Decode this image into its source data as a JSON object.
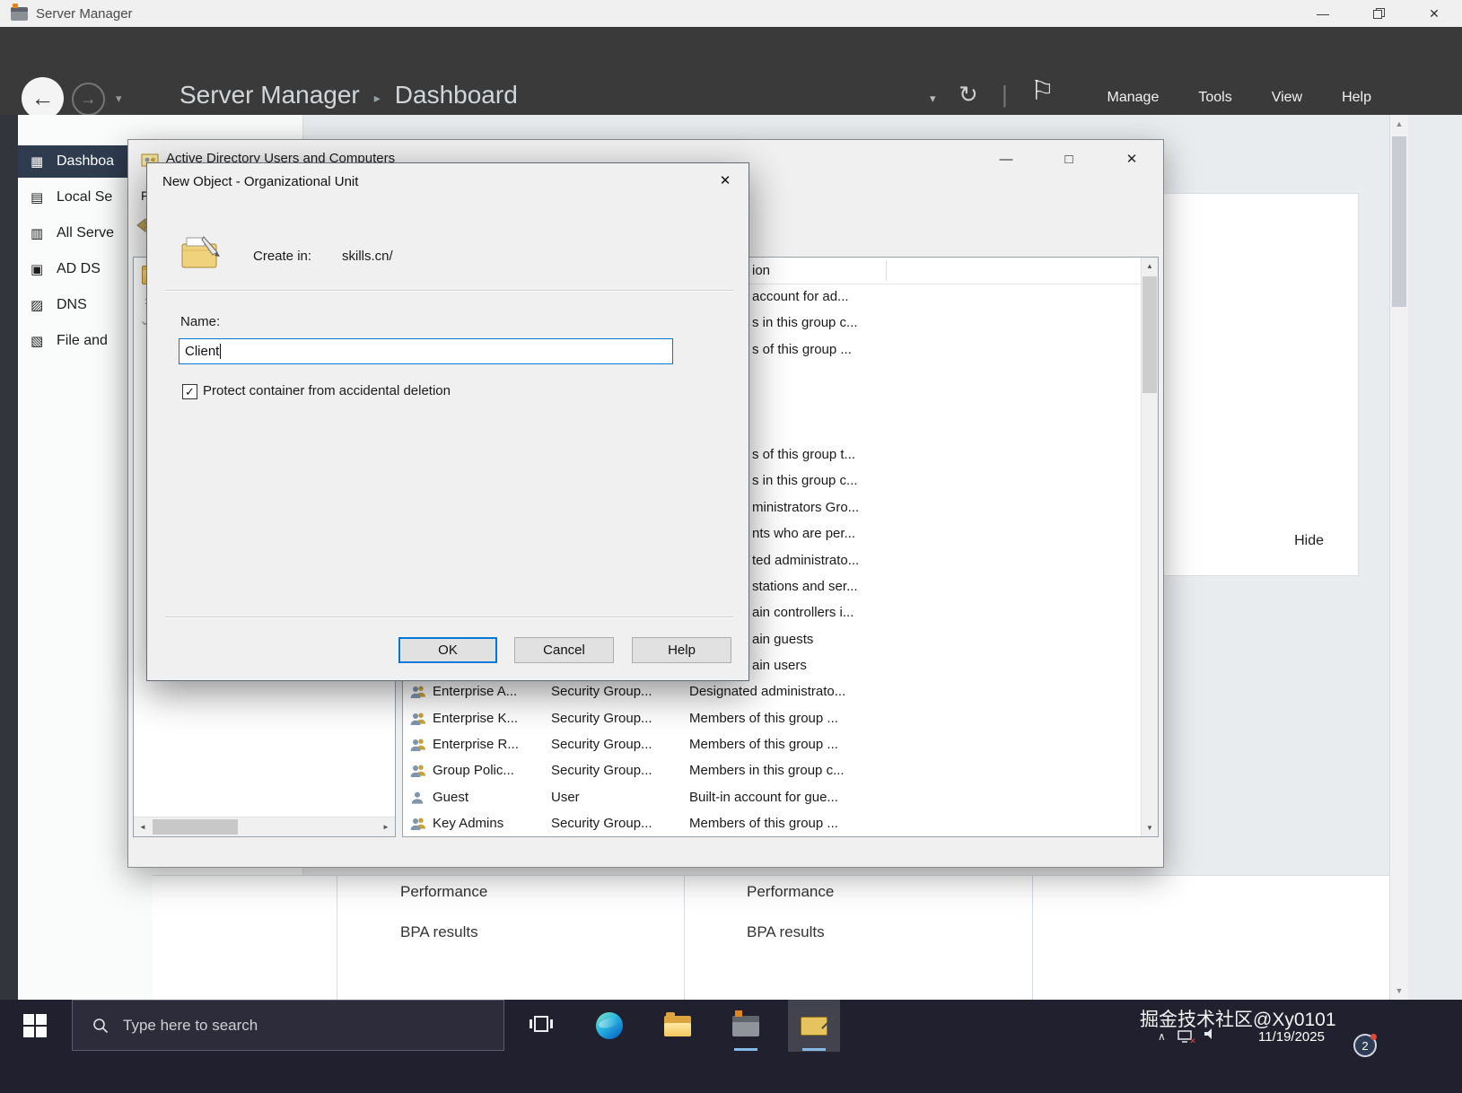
{
  "titlebar": {
    "title": "Server Manager"
  },
  "navbar": {
    "breadcrumb_root": "Server Manager",
    "breadcrumb_current": "Dashboard",
    "menus": [
      "Manage",
      "Tools",
      "View",
      "Help"
    ]
  },
  "sidebar": {
    "items": [
      {
        "label": "Dashboa",
        "icon": "dashboard-icon",
        "glyph": "▦",
        "active": true
      },
      {
        "label": "Local Se",
        "icon": "local-server-icon",
        "glyph": "▤",
        "active": false
      },
      {
        "label": "All Serve",
        "icon": "all-servers-icon",
        "glyph": "▥",
        "active": false
      },
      {
        "label": "AD DS",
        "icon": "ad-ds-icon",
        "glyph": "▣",
        "active": false
      },
      {
        "label": "DNS",
        "icon": "dns-icon",
        "glyph": "▨",
        "active": false
      },
      {
        "label": "File and",
        "icon": "file-storage-icon",
        "glyph": "▧",
        "active": false
      }
    ]
  },
  "welcome_panel": {
    "hide_label": "Hide"
  },
  "role_tiles": [
    {
      "links": [
        "Performance",
        "BPA results"
      ]
    },
    {
      "links": [
        "Performance",
        "BPA results"
      ]
    }
  ],
  "ad_window": {
    "title": "Active Directory Users and Computers",
    "menu_visible": "F",
    "list": {
      "header_partial": "ion",
      "partial_descriptions": [
        "account for ad...",
        "s in this group c...",
        "s of this group ...",
        "",
        "",
        "",
        "s of this group t...",
        "s in this group c...",
        "ministrators Gro...",
        "nts who are per...",
        "ted administrato...",
        "stations and ser...",
        "ain controllers i...",
        "ain guests",
        "ain users"
      ],
      "rows": [
        {
          "icon": "group",
          "name": "Enterprise A...",
          "type": "Security Group...",
          "description": "Designated administrato..."
        },
        {
          "icon": "group",
          "name": "Enterprise K...",
          "type": "Security Group...",
          "description": "Members of this group ..."
        },
        {
          "icon": "group",
          "name": "Enterprise R...",
          "type": "Security Group...",
          "description": "Members of this group ..."
        },
        {
          "icon": "group",
          "name": "Group Polic...",
          "type": "Security Group...",
          "description": "Members in this group c..."
        },
        {
          "icon": "user",
          "name": "Guest",
          "type": "User",
          "description": "Built-in account for gue..."
        },
        {
          "icon": "group",
          "name": "Key Admins",
          "type": "Security Group...",
          "description": "Members of this group ..."
        }
      ]
    }
  },
  "dialog": {
    "title": "New Object - Organizational Unit",
    "create_in_label": "Create in:",
    "create_in_value": "skills.cn/",
    "name_label": "Name:",
    "name_value": "Client",
    "protect_label": "Protect container from accidental deletion",
    "protect_checked": true,
    "ok_label": "OK",
    "cancel_label": "Cancel",
    "help_label": "Help"
  },
  "taskbar": {
    "search_placeholder": "Type here to search",
    "watermark": "掘金技术社区@Xy0101",
    "date": "11/19/2025",
    "badge_count": "2"
  },
  "icons": {
    "minimize": "—",
    "maximize": "□",
    "close": "✕",
    "back": "←",
    "forward": "→",
    "caret_down": "▾",
    "refresh": "↻",
    "pipe": "|",
    "flag": "⚐",
    "breadcrumb_sep": "▸",
    "scroll_up": "▲",
    "scroll_down": "▼",
    "scroll_left": "◄",
    "scroll_right": "►",
    "tree_chevron": "›",
    "check": "✓",
    "tray_chevron": "∧"
  },
  "colors": {
    "accent": "#0078d7",
    "navbar_bg": "#3a3a3a",
    "sidebar_active_bg": "#2f3c50",
    "taskbar_bg": "#20202e"
  }
}
